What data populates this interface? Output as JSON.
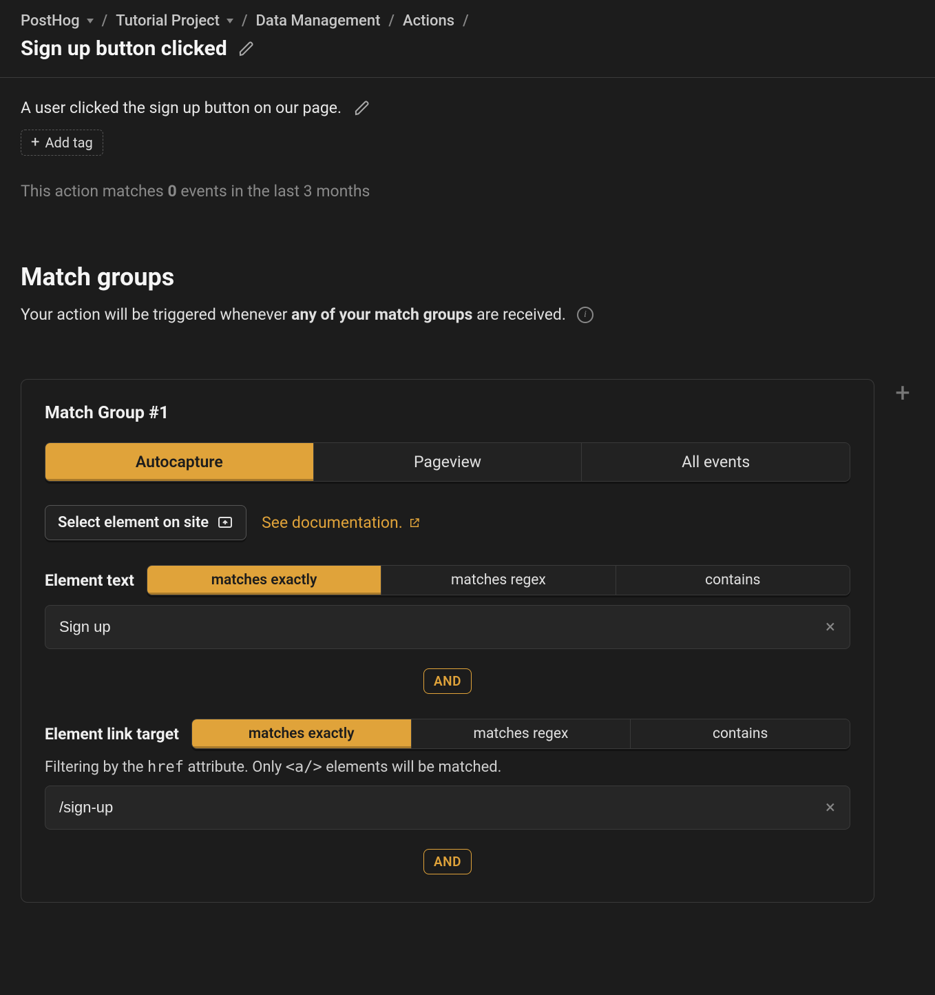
{
  "breadcrumb": {
    "org": "PostHog",
    "project": "Tutorial Project",
    "section": "Data Management",
    "subsection": "Actions"
  },
  "page": {
    "title": "Sign up button clicked",
    "description": "A user clicked the sign up button on our page.",
    "add_tag": "Add tag",
    "stats_prefix": "This action matches ",
    "stats_count": "0",
    "stats_suffix": " events in the last 3 months"
  },
  "match": {
    "heading": "Match groups",
    "sub_prefix": "Your action will be triggered whenever ",
    "sub_bold": "any of your match groups",
    "sub_suffix": " are received."
  },
  "group": {
    "title": "Match Group #1",
    "tabs": {
      "autocapture": "Autocapture",
      "pageview": "Pageview",
      "all": "All events"
    },
    "select_element": "Select element on site",
    "see_docs": "See documentation.",
    "match_ops": {
      "exact": "matches exactly",
      "regex": "matches regex",
      "contains": "contains"
    },
    "element_text_label": "Element text",
    "element_text_value": "Sign up",
    "and_label": "AND",
    "link_target_label": "Element link target",
    "link_help_a": "Filtering by the ",
    "link_help_code1": "href",
    "link_help_b": " attribute. Only ",
    "link_help_code2": "<a/>",
    "link_help_c": " elements will be matched.",
    "link_target_value": "/sign-up"
  }
}
